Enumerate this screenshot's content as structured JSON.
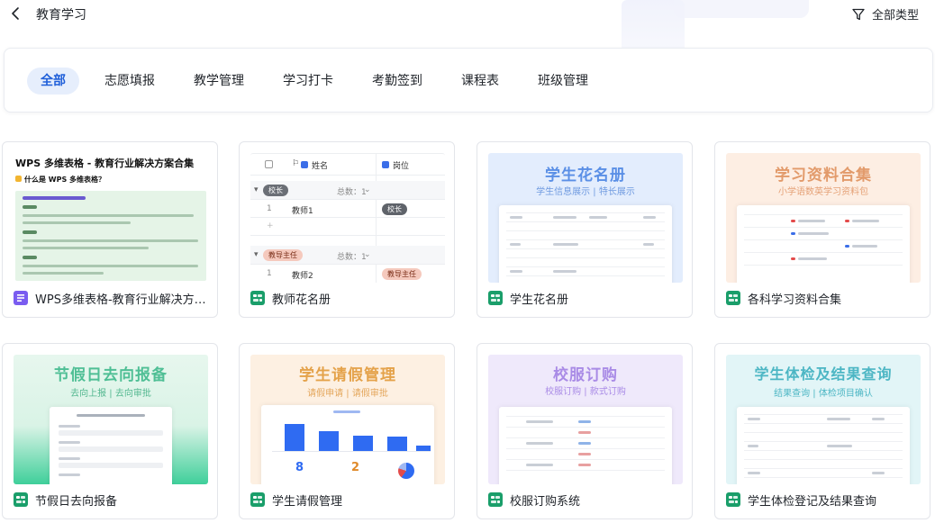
{
  "header": {
    "title": "教育学习",
    "filter_label": "全部类型"
  },
  "tabs": [
    {
      "label": "全部",
      "active": true
    },
    {
      "label": "志愿填报",
      "active": false
    },
    {
      "label": "教学管理",
      "active": false
    },
    {
      "label": "学习打卡",
      "active": false
    },
    {
      "label": "考勤签到",
      "active": false
    },
    {
      "label": "课程表",
      "active": false
    },
    {
      "label": "班级管理",
      "active": false
    }
  ],
  "cards": [
    {
      "name": "WPS多维表格-教育行业解决方案合集",
      "icon": "doc-icon",
      "thumb": {
        "heading": "WPS 多维表格 - 教育行业解决方案合集",
        "question": "什么是 WPS 多维表格？"
      }
    },
    {
      "name": "教师花名册",
      "icon": "table-app-icon",
      "thumb": {
        "col_name": "姓名",
        "col_post": "岗位",
        "group1": "校长",
        "group1_count": "总数：1",
        "row1_idx": "1",
        "row1_name": "教师1",
        "row1_post": "校长",
        "group2": "教导主任",
        "group2_count": "总数：1",
        "row2_idx": "1",
        "row2_name": "教师2",
        "row2_post": "教导主任"
      }
    },
    {
      "name": "学生花名册",
      "icon": "table-app-icon",
      "thumb": {
        "title": "学生花名册",
        "subtitle": "学生信息展示 | 特长展示"
      }
    },
    {
      "name": "各科学习资料合集",
      "icon": "table-app-icon",
      "thumb": {
        "title": "学习资料合集",
        "subtitle": "小学语数英学习资料包"
      }
    },
    {
      "name": "节假日去向报备",
      "icon": "table-app-icon",
      "thumb": {
        "title": "节假日去向报备",
        "subtitle": "去向上报 | 去向审批"
      }
    },
    {
      "name": "学生请假管理",
      "icon": "table-app-icon",
      "thumb": {
        "title": "学生请假管理",
        "subtitle": "请假申请 | 请假审批",
        "stat1": "8",
        "stat2": "2"
      }
    },
    {
      "name": "校服订购系统",
      "icon": "table-app-icon",
      "thumb": {
        "title": "校服订购",
        "subtitle": "校服订购 | 款式订购"
      }
    },
    {
      "name": "学生体检登记及结果查询",
      "icon": "table-app-icon",
      "thumb": {
        "title": "学生体检及结果查询",
        "subtitle": "结果查询 | 体检项目确认"
      }
    }
  ],
  "colors": {
    "accent": "#1f5fd9",
    "active_tab_bg": "#e6eefc",
    "doc_icon": "#7a5cf0",
    "table_icon": "#1a9e6a"
  }
}
